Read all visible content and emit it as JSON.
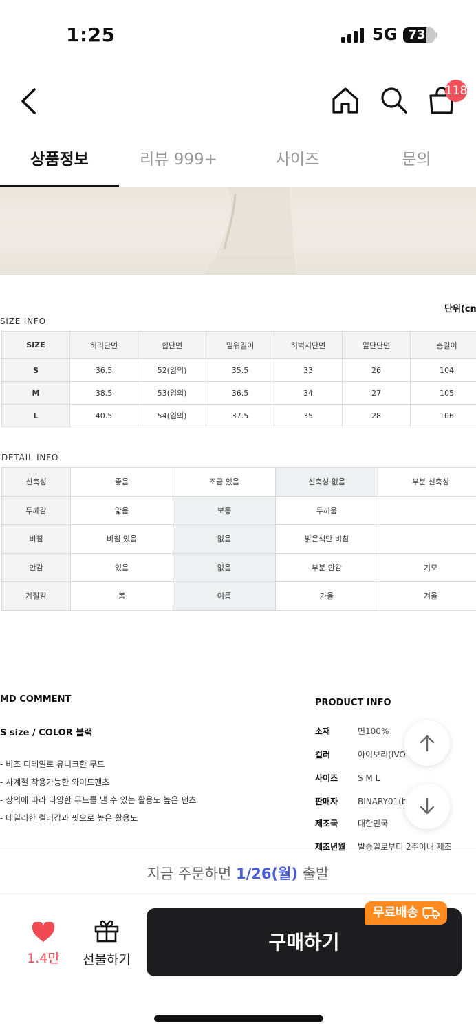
{
  "status_bar": {
    "time": "1:25",
    "network": "5G",
    "battery": "73",
    "battery_level": 0.73
  },
  "nav": {
    "cart_badge": "118"
  },
  "tabs": [
    {
      "label": "상품정보",
      "active": true
    },
    {
      "label": "리뷰 999+",
      "active": false
    },
    {
      "label": "사이즈",
      "active": false
    },
    {
      "label": "문의",
      "active": false
    }
  ],
  "size_info": {
    "unit_label": "단위(cm",
    "title": "SIZE INFO",
    "headers": [
      "SIZE",
      "허리단면",
      "힙단면",
      "밑위길이",
      "허벅지단면",
      "밑단단면",
      "총길이"
    ],
    "rows": [
      [
        "S",
        "36.5",
        "52(임의)",
        "35.5",
        "33",
        "26",
        "104"
      ],
      [
        "M",
        "38.5",
        "53(임의)",
        "36.5",
        "34",
        "27",
        "105"
      ],
      [
        "L",
        "40.5",
        "54(임의)",
        "37.5",
        "35",
        "28",
        "106"
      ]
    ]
  },
  "detail_info": {
    "title": "DETAIL INFO",
    "rows": [
      [
        "신축성",
        "좋음",
        "조금 있음",
        "신축성 없음",
        "부분 신축성"
      ],
      [
        "두께감",
        "얇음",
        "보통",
        "두꺼움",
        ""
      ],
      [
        "비침",
        "비침 있음",
        "없음",
        "밝은색만 비침",
        ""
      ],
      [
        "안감",
        "있음",
        "없음",
        "부분 안감",
        "기모"
      ],
      [
        "계절감",
        "봄",
        "여름",
        "가을",
        "겨울"
      ]
    ]
  },
  "md_comment": {
    "title": "MD COMMENT",
    "subtitle": "S size / COLOR 블랙",
    "lines": [
      "- 비조 디테일로 유니크한 무드",
      "- 사계절 착용가능한 와이드팬츠",
      "- 상의에 따라 다양한 무드를 낼 수 있는 활용도 높은 팬츠",
      "- 데일리한 컬러감과 핏으로 높은 활용도"
    ]
  },
  "product_info": {
    "title": "PRODUCT INFO",
    "rows": [
      {
        "key": "소재",
        "value": "면100%"
      },
      {
        "key": "컬러",
        "value": "아이보리(IVO        LACK)"
      },
      {
        "key": "사이즈",
        "value": "S M L"
      },
      {
        "key": "판매자",
        "value": "BINARY01(b"
      },
      {
        "key": "제조국",
        "value": "대한민국"
      },
      {
        "key": "제조년월",
        "value": "발송일로부터 2주이내 제조"
      }
    ]
  },
  "delivery": {
    "prefix": "지금 주문하면 ",
    "date": "1/26(월)",
    "suffix": " 출발"
  },
  "bottom_bar": {
    "like_count": "1.4만",
    "gift_label": "선물하기",
    "buy_label": "구매하기",
    "free_shipping": "무료배송"
  },
  "colors": {
    "accent_blue": "#4a5bd6",
    "heart_red": "#f04a55",
    "badge_orange": "#ff8a1f",
    "buy_button": "#1d1d1f"
  }
}
